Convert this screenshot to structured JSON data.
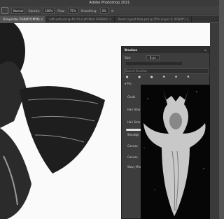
{
  "window": {
    "title": "Adobe Photoshop 2021"
  },
  "options_bar": {
    "mode_value": "Normal",
    "opacity_label": "Opacity:",
    "opacity_value": "100%",
    "flow_label": "Flow:",
    "flow_value": "75%",
    "smoothing_label": "Smoothing:",
    "smoothing_value": "0%"
  },
  "tabs": [
    {
      "label": "(Grayscale, RGB/8*/CMYK) ×"
    },
    {
      "label": "Loft wall.psd @ 46.3% (Loft Wall, RGB/8#) ×"
    },
    {
      "label": "Room Layout Idea.psd @ 50% (Layer 9, RGB/8*) ×"
    }
  ],
  "brushes_panel": {
    "title": "Brushes",
    "size_label": "Size:",
    "size_value": "8 px",
    "search_placeholder": "Search Brushes",
    "folder_label": "Pro",
    "items": [
      {
        "label": "Chalk"
      },
      {
        "label": "Hair Smo"
      },
      {
        "label": "Hair Smo"
      },
      {
        "label": "Smudge"
      },
      {
        "label": "Canvas"
      },
      {
        "label": "Canvas"
      },
      {
        "label": "Wavy Mix"
      }
    ]
  },
  "colors": {
    "accent": "#2d8ceb",
    "panel": "#3d3d3d",
    "chrome": "#535353"
  }
}
